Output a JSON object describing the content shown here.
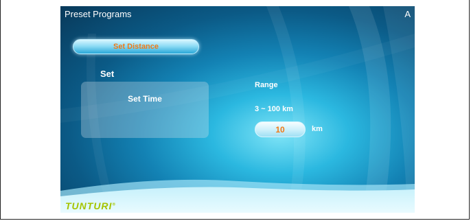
{
  "header": {
    "title": "Preset Programs",
    "corner_label": "A"
  },
  "set_panel": {
    "heading": "Set",
    "options": {
      "set_time": "Set Time",
      "set_distance": "Set Distance"
    },
    "selected": "Set Distance",
    "selected_text_color": "#f07a17"
  },
  "range": {
    "label": "Range",
    "value": "3 ~ 100 km"
  },
  "distance_input": {
    "value": "10",
    "unit": "km"
  },
  "brand": {
    "logo_text": "TUNTURI",
    "logo_color": "#a5c400"
  },
  "colors": {
    "background_dark": "#08395a",
    "background_light": "#7fe4f7",
    "accent_orange": "#f07a17"
  }
}
